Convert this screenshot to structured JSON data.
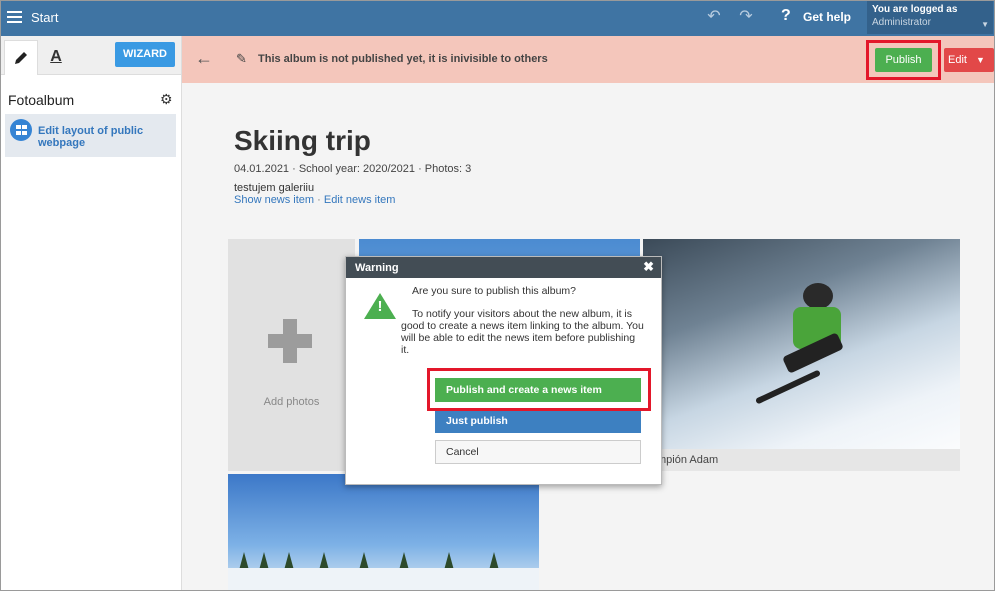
{
  "topbar": {
    "title": "Start",
    "help_label": "Get help",
    "help_glyph": "?",
    "logged_title": "You are logged as",
    "logged_user": "Administrator"
  },
  "sidebar": {
    "wizard_label": "WIZARD",
    "tab_design_glyph": "A",
    "section_title": "Fotoalbum",
    "items": [
      {
        "label": "Edit layout of public webpage",
        "icon": "layout-grid-icon"
      }
    ]
  },
  "notice": {
    "text": "This album is not published yet, it is inivisible to others",
    "publish_label": "Publish",
    "edit_label": "Edit"
  },
  "album": {
    "title": "Skiing trip",
    "meta": "04.01.2021 · School year: 2020/2021 · Photos: 3",
    "description": "testujem galeriiu",
    "link_show": "Show news item",
    "link_separator": "·",
    "link_edit": "Edit news item",
    "add_photos_label": "Add photos",
    "photo_caption": "mpión Adam"
  },
  "dialog": {
    "title": "Warning",
    "question": "Are you sure to publish this album?",
    "body": "To notify your visitors about the new album, it is good to create a news item linking to the album. You will be able to edit the news item before publishing it.",
    "btn_publish_create": "Publish and create a news item",
    "btn_just_publish": "Just publish",
    "btn_cancel": "Cancel"
  },
  "colors": {
    "topbar": "#3f74a3",
    "notice_bg": "#f4c6bb",
    "publish_green": "#4caf50",
    "edit_red": "#e24848",
    "highlight_red": "#e3172a",
    "link_blue": "#3477bd"
  }
}
